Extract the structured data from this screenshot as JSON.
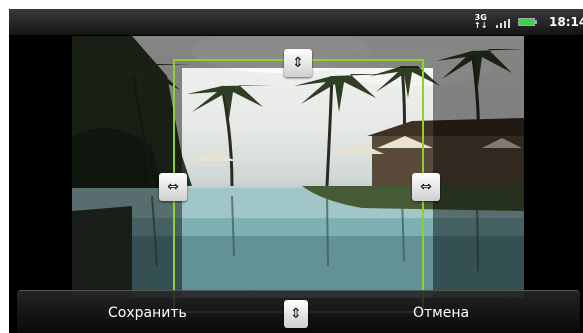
{
  "status_bar": {
    "network_type_top": "3G",
    "network_type_bottom": "↑↓",
    "time": "18:14",
    "battery_color": "#3cd34a"
  },
  "crop_editor": {
    "frame_color": "#8fd12c",
    "handles": {
      "top": "⇕",
      "left": "⇔",
      "right": "⇔",
      "bottom": "⇕"
    }
  },
  "actions": {
    "save_label": "Сохранить",
    "cancel_label": "Отмена"
  }
}
